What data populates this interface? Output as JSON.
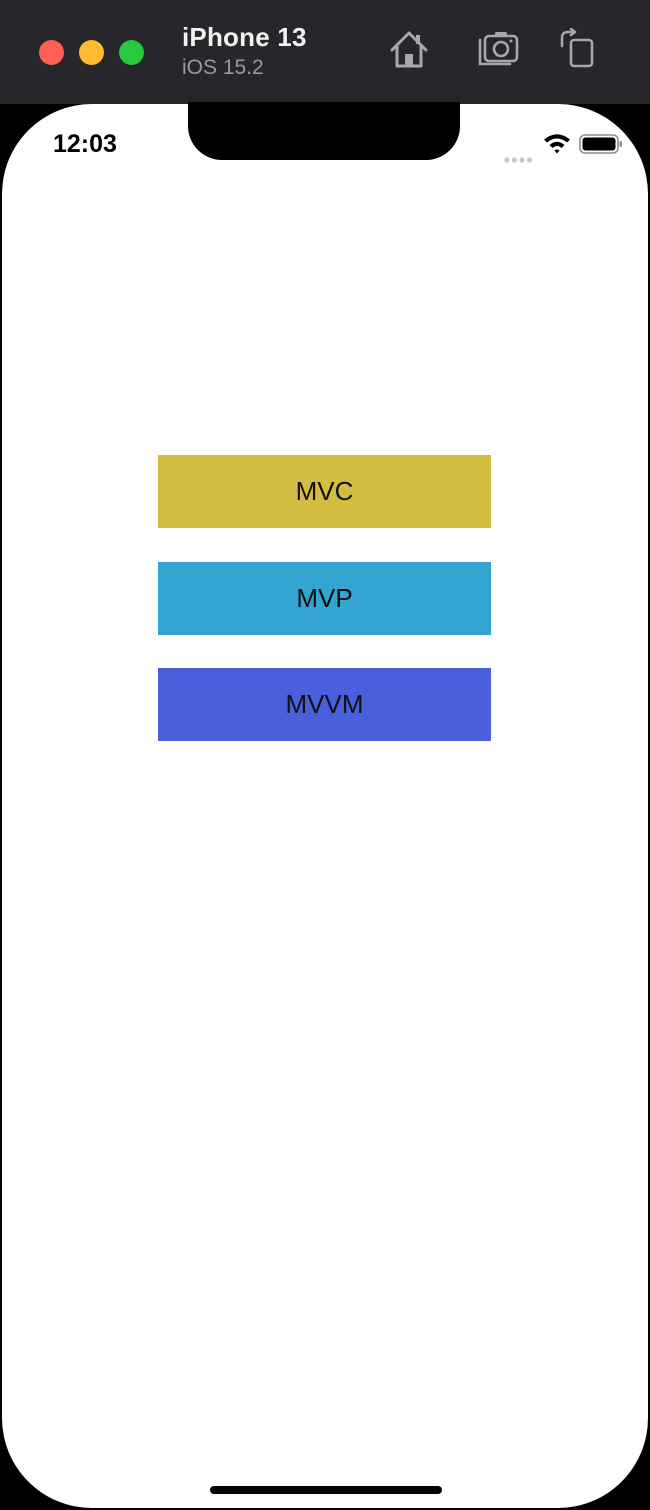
{
  "titlebar": {
    "device_name": "iPhone 13",
    "os_version": "iOS 15.2",
    "icons": [
      "home-icon",
      "screenshot-icon",
      "rotate-icon"
    ]
  },
  "status_bar": {
    "time": "12:03",
    "icons": [
      "cellular-signal-icon",
      "wifi-icon",
      "battery-icon"
    ]
  },
  "buttons": [
    {
      "label": "MVC",
      "color": "#d4bc40"
    },
    {
      "label": "MVP",
      "color": "#33a5d0"
    },
    {
      "label": "MVVM",
      "color": "#4a5fdc"
    }
  ],
  "colors": {
    "titlebar_bg": "#27262a",
    "close": "#fe5f57",
    "minimize": "#febc2e",
    "maximize": "#28c840"
  }
}
